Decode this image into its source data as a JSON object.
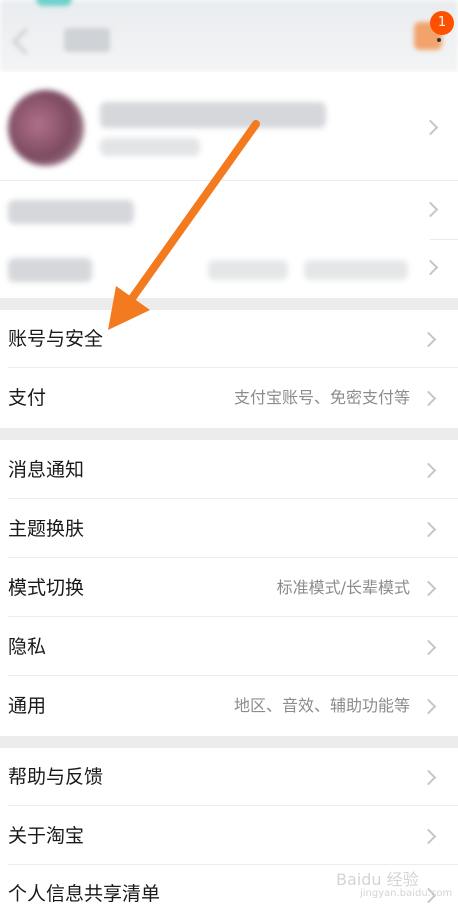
{
  "header": {
    "notification_count": "1"
  },
  "sections": [
    {
      "items": [
        {
          "label": "账号与安全",
          "sub": ""
        },
        {
          "label": "支付",
          "sub": "支付宝账号、免密支付等"
        }
      ]
    },
    {
      "items": [
        {
          "label": "消息通知",
          "sub": ""
        },
        {
          "label": "主题换肤",
          "sub": ""
        },
        {
          "label": "模式切换",
          "sub": "标准模式/长辈模式"
        },
        {
          "label": "隐私",
          "sub": ""
        },
        {
          "label": "通用",
          "sub": "地区、音效、辅助功能等"
        }
      ]
    },
    {
      "items": [
        {
          "label": "帮助与反馈",
          "sub": ""
        },
        {
          "label": "关于淘宝",
          "sub": ""
        },
        {
          "label": "个人信息共享清单",
          "sub": ""
        }
      ]
    }
  ],
  "watermark": {
    "brand": "Baidu 经验",
    "url": "jingyan.baidu.com"
  },
  "colors": {
    "annotation_arrow": "#f47a20",
    "badge": "#ff5000",
    "section_gap": "#ececec"
  }
}
